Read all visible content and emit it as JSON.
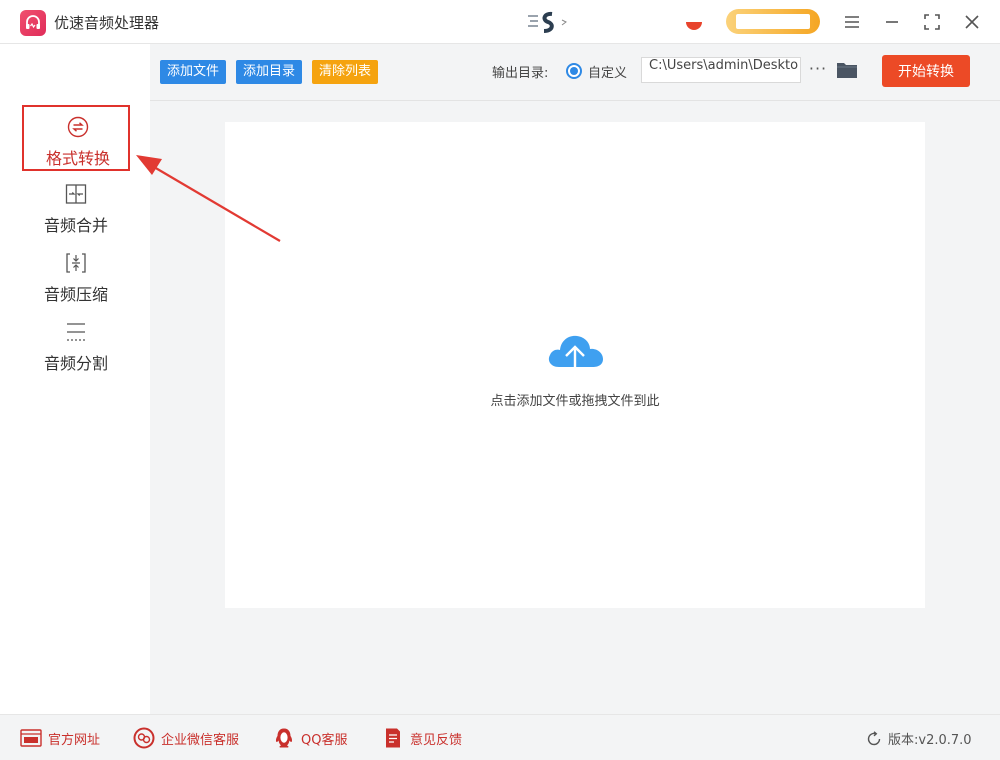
{
  "app": {
    "title": "优速音频处理器"
  },
  "sidebar": {
    "items": [
      {
        "label": "格式转换",
        "icon": "format-convert-icon",
        "active": true
      },
      {
        "label": "音频合并",
        "icon": "audio-merge-icon",
        "active": false
      },
      {
        "label": "音频压缩",
        "icon": "audio-compress-icon",
        "active": false
      },
      {
        "label": "音频分割",
        "icon": "audio-split-icon",
        "active": false
      }
    ]
  },
  "toolbar": {
    "add_file": "添加文件",
    "add_dir": "添加目录",
    "clear_list": "清除列表",
    "output_label": "输出目录:",
    "radio_label": "自定义",
    "output_path": "C:\\Users\\admin\\Deskto",
    "more": "···",
    "start": "开始转换"
  },
  "dropzone": {
    "hint": "点击添加文件或拖拽文件到此"
  },
  "footer": {
    "links": [
      {
        "label": "官方网址",
        "icon": "website-icon"
      },
      {
        "label": "企业微信客服",
        "icon": "wechat-service-icon"
      },
      {
        "label": "QQ客服",
        "icon": "qq-icon"
      },
      {
        "label": "意见反馈",
        "icon": "feedback-icon"
      }
    ],
    "version": "版本:v2.0.7.0"
  },
  "colors": {
    "accent_blue": "#2e89e5",
    "accent_orange": "#f5a30f",
    "start_red": "#ec4a26",
    "active_red": "#e0322c"
  }
}
